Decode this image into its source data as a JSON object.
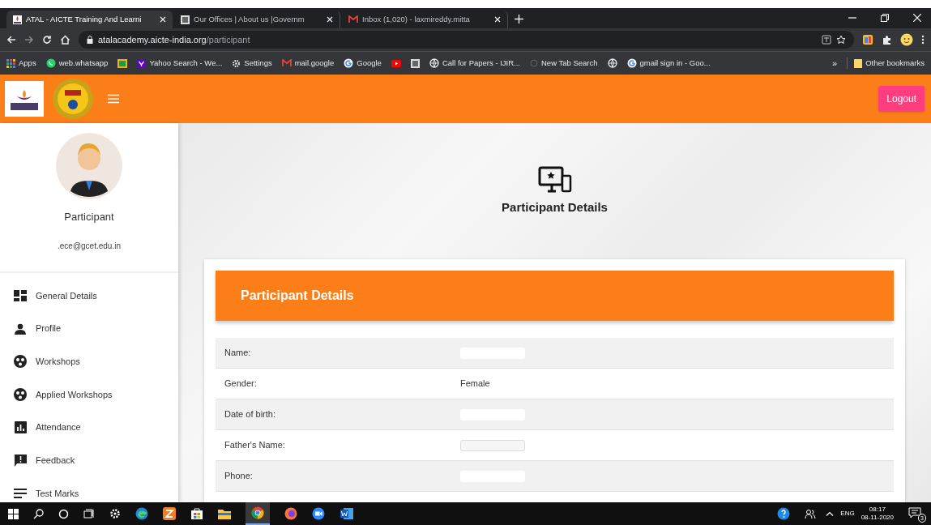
{
  "browser": {
    "tabs": [
      {
        "title": "ATAL - AICTE Training And Learni",
        "selected": true,
        "kind": "atal"
      },
      {
        "title": "Our Offices | About us |Governm",
        "selected": false,
        "kind": "page"
      },
      {
        "title": "Inbox (1,020) - laxmireddy.mitta",
        "selected": false,
        "kind": "gmail"
      }
    ],
    "address": {
      "host": "atalacademy.aicte-india.org",
      "path": "/participant"
    },
    "bookmarks": [
      {
        "label": "Apps",
        "kind": "apps"
      },
      {
        "label": "web.whatsapp",
        "kind": "whatsapp"
      },
      {
        "kind": "classroom"
      },
      {
        "label": "Yahoo Search - We...",
        "kind": "yahoo"
      },
      {
        "label": "Settings",
        "kind": "gear"
      },
      {
        "label": "mail.google",
        "kind": "gmail"
      },
      {
        "label": "Google",
        "kind": "google"
      },
      {
        "kind": "youtube"
      },
      {
        "kind": "page"
      },
      {
        "label": "Call for Papers - IJIR...",
        "kind": "globe"
      },
      {
        "label": "New Tab Search",
        "kind": "circle"
      },
      {
        "kind": "globe"
      },
      {
        "label": "gmail sign in - Goo...",
        "kind": "google"
      }
    ],
    "more": "»",
    "other_bookmarks": "Other bookmarks"
  },
  "header": {
    "logout": "Logout"
  },
  "sidebar": {
    "role": "Participant",
    "email": ".ece@gcet.edu.in",
    "items": [
      {
        "label": "General Details",
        "kind": "dashboard"
      },
      {
        "label": "Profile",
        "kind": "person"
      },
      {
        "label": "Workshops",
        "kind": "reel"
      },
      {
        "label": "Applied Workshops",
        "kind": "reel"
      },
      {
        "label": "Attendance",
        "kind": "chart"
      },
      {
        "label": "Feedback",
        "kind": "feedback"
      },
      {
        "label": "Test Marks",
        "kind": "lines"
      }
    ]
  },
  "hero": {
    "title": "Participant Details"
  },
  "card": {
    "title": "Participant Details",
    "rows": [
      {
        "label": "Name:"
      },
      {
        "label": "Gender:",
        "value": "Female"
      },
      {
        "label": "Date of birth:"
      },
      {
        "label": "Father's Name:"
      },
      {
        "label": "Phone:"
      }
    ]
  },
  "taskbar": {
    "language": "ENG",
    "time": "08:17",
    "date": "08-11-2020",
    "notifications": "3"
  }
}
